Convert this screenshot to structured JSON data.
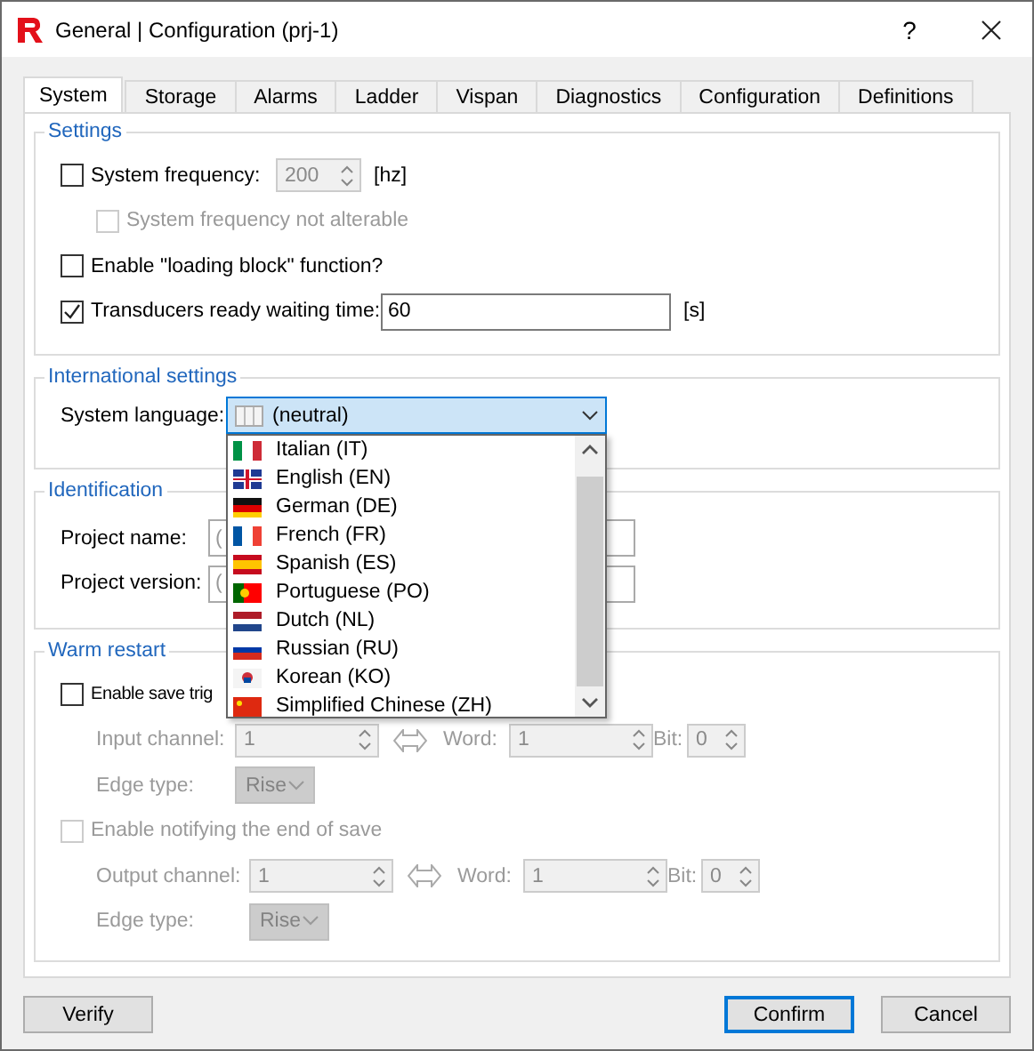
{
  "window": {
    "title": "General | Configuration (prj-1)",
    "help": "?"
  },
  "tabs": [
    {
      "label": "System",
      "selected": true
    },
    {
      "label": "Storage",
      "selected": false
    },
    {
      "label": "Alarms",
      "selected": false
    },
    {
      "label": "Ladder",
      "selected": false
    },
    {
      "label": "Vispan",
      "selected": false
    },
    {
      "label": "Diagnostics",
      "selected": false
    },
    {
      "label": "Configuration",
      "selected": false
    },
    {
      "label": "Definitions",
      "selected": false
    }
  ],
  "settings": {
    "title": "Settings",
    "frequency": {
      "label": "System frequency:",
      "checked": false,
      "value": "200",
      "disabled": true,
      "unit": "[hz]"
    },
    "not_alterable": {
      "label": "System frequency not alterable",
      "checked": false,
      "disabled": true
    },
    "loading_block": {
      "label": "Enable \"loading block\" function?",
      "checked": false,
      "disabled": false
    },
    "transducers": {
      "label": "Transducers ready waiting time:",
      "checked": true,
      "disabled": false,
      "value": "60",
      "unit": "[s]"
    }
  },
  "international": {
    "title": "International settings",
    "label": "System language:",
    "value": "(neutral)",
    "expanded": true,
    "options": [
      {
        "label": "Italian (IT)",
        "selected": false
      },
      {
        "label": "English (EN)",
        "selected": false
      },
      {
        "label": "German (DE)",
        "selected": false
      },
      {
        "label": "French (FR)",
        "selected": false
      },
      {
        "label": "Spanish (ES)",
        "selected": false
      },
      {
        "label": "Portuguese (PO)",
        "selected": false
      },
      {
        "label": "Dutch (NL)",
        "selected": false
      },
      {
        "label": "Russian (RU)",
        "selected": false
      },
      {
        "label": "Korean (KO)",
        "selected": false
      },
      {
        "label": "Simplified Chinese (ZH)",
        "selected": false
      }
    ]
  },
  "identification": {
    "title": "Identification",
    "name_label": "Project name:",
    "name_value": "(",
    "version_label": "Project version:",
    "version_value": "("
  },
  "warm_restart": {
    "title": "Warm restart",
    "save_trigger": {
      "label": "Enable save trig",
      "checked": false,
      "disabled": false
    },
    "input": {
      "channel_label": "Input channel:",
      "channel": "1",
      "word_label": "Word:",
      "word": "1",
      "bit_label": "Bit:",
      "bit": "0",
      "disabled": true
    },
    "input_edge": {
      "label": "Edge type:",
      "value": "Rise",
      "disabled": true
    },
    "notify": {
      "label": "Enable notifying the end of save",
      "checked": false,
      "disabled": true
    },
    "output": {
      "channel_label": "Output channel:",
      "channel": "1",
      "word_label": "Word:",
      "word": "1",
      "bit_label": "Bit:",
      "bit": "0",
      "disabled": true
    },
    "output_edge": {
      "label": "Edge type:",
      "value": "Rise",
      "disabled": true
    }
  },
  "buttons": [
    {
      "label": "Verify",
      "default": false
    },
    {
      "label": "Confirm",
      "default": true
    },
    {
      "label": "Cancel",
      "default": false
    }
  ]
}
